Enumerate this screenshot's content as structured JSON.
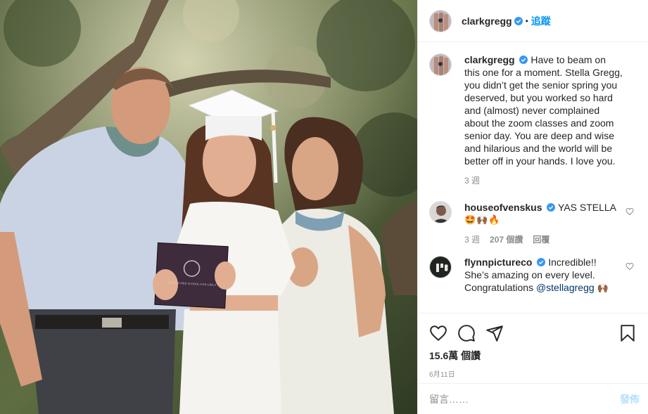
{
  "photo": {
    "alt": "Family graduation photo",
    "diploma_text": "THE ARCHER SCHOOL FOR GIRLS"
  },
  "header": {
    "username": "clarkgregg",
    "separator": "•",
    "follow_label": "追蹤"
  },
  "caption": {
    "username": "clarkgregg",
    "text": "Have to beam on this one for a moment. Stella Gregg, you didn’t get the senior spring you deserved, but you worked so hard and (almost) never complained about the zoom classes and zoom senior day. You are deep and wise and hilarious and the world will be better off in your hands. I love you.",
    "time": "3 週"
  },
  "comments": [
    {
      "username": "houseofvenskus",
      "text": "YAS STELLA",
      "emoji": "🤩🙌🏾🔥",
      "time": "3 週",
      "likes": "207 個讚",
      "reply": "回覆"
    },
    {
      "username": "flynnpictureco",
      "text": "Incredible!! She’s amazing on every level. Congratulations",
      "mention": "@stellagregg",
      "emoji": "🙌🏾"
    }
  ],
  "stats": {
    "likes": "15.6萬 個讚",
    "date": "6月11日"
  },
  "add_comment": {
    "placeholder": "留言……",
    "post_label": "發佈"
  },
  "icons": {
    "like": "heart-icon",
    "comment": "comment-icon",
    "share": "share-icon",
    "save": "bookmark-icon",
    "verified": "verified-badge-icon"
  },
  "colors": {
    "accent": "#0095f6",
    "verified": "#3897f0",
    "post_disabled": "#b2dffc",
    "mention": "#00376b"
  }
}
